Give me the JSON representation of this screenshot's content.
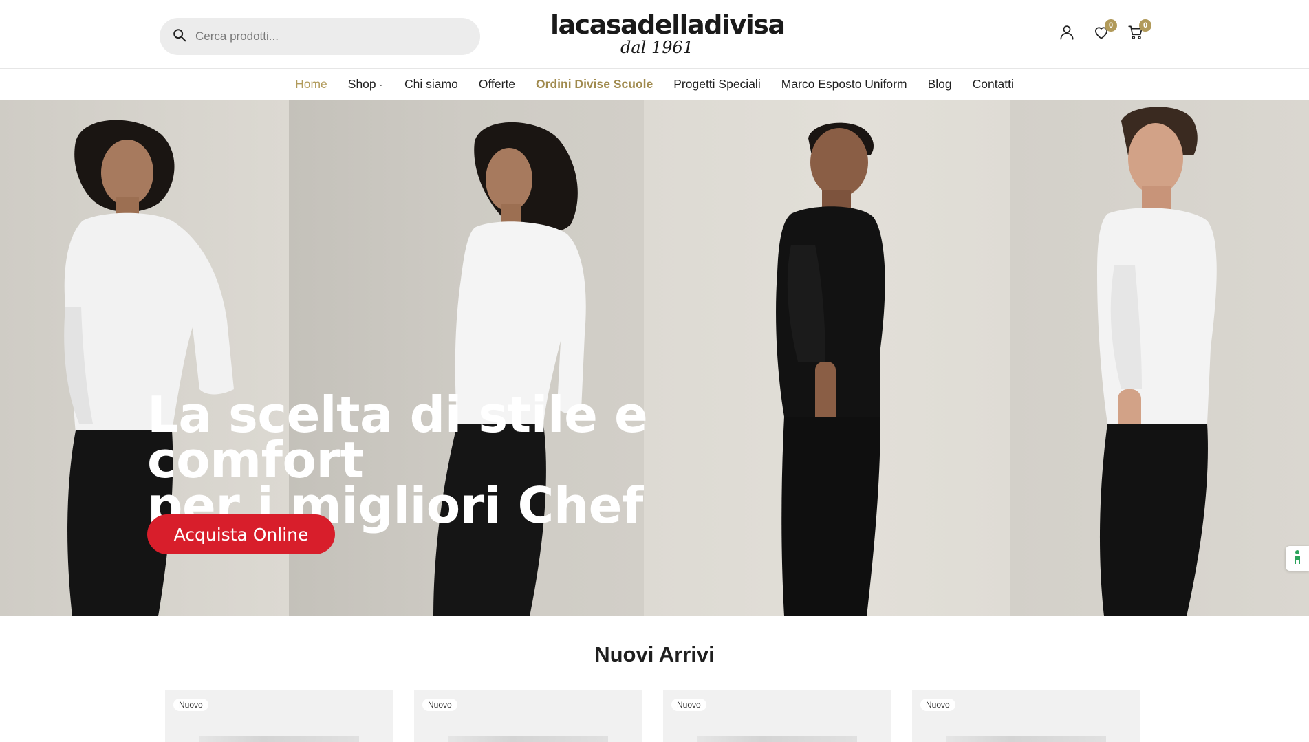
{
  "header": {
    "search_placeholder": "Cerca prodotti...",
    "logo_main": "lacasadelladivisa",
    "logo_sub": "dal 1961",
    "wishlist_count": "0",
    "cart_count": "0"
  },
  "nav": {
    "items": [
      {
        "label": "Home"
      },
      {
        "label": "Shop"
      },
      {
        "label": "Chi siamo"
      },
      {
        "label": "Offerte"
      },
      {
        "label": "Ordini Divise Scuole"
      },
      {
        "label": "Progetti Speciali"
      },
      {
        "label": "Marco Esposto Uniform"
      },
      {
        "label": "Blog"
      },
      {
        "label": "Contatti"
      }
    ]
  },
  "hero": {
    "title_line1": "La scelta di stile e comfort",
    "title_line2": "per i migliori Chef",
    "cta_label": "Acquista Online"
  },
  "new_arrivals": {
    "title": "Nuovi Arrivi",
    "products": [
      {
        "tag": "Nuovo"
      },
      {
        "tag": "Nuovo"
      },
      {
        "tag": "Nuovo"
      },
      {
        "tag": "Nuovo"
      }
    ]
  },
  "colors": {
    "accent_gold": "#b19a5a",
    "cta_red": "#d81e2b"
  }
}
